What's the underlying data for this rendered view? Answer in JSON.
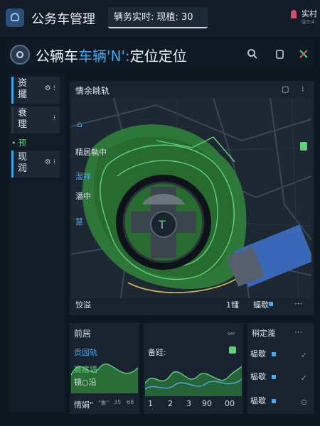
{
  "header": {
    "app_title": "公务车管理",
    "tab_label": "辆务实时: 现植: 30",
    "user_label": "实村",
    "user_sub": "@3:4"
  },
  "subheader": {
    "title_a": "公辆车",
    "title_b": "车辆",
    "title_c": "'N':",
    "title_d": "定位定位"
  },
  "sidebar": {
    "items": [
      {
        "label": "资擺"
      },
      {
        "label": "衰理"
      },
      {
        "label": "现润"
      }
    ],
    "dot_label": "预"
  },
  "map_panel": {
    "title": "情余眺轨",
    "labels": [
      "精居執中",
      "湿祥",
      "潘中",
      "慧"
    ],
    "foot_left": "饺溢",
    "foot_count": "1镭",
    "foot_right": "蝠歇"
  },
  "bottom": {
    "left": {
      "title": "前居",
      "items": [
        "贡园轨",
        "赛瘩墙",
        "镜○沿"
      ],
      "foot_label": "情娟\"",
      "foot_nums": [
        "\"象\"",
        "35",
        "68"
      ]
    },
    "middle": {
      "label": "备跬:",
      "corner": "ser",
      "ticks": [
        "1",
        "2",
        "3",
        "90",
        "00"
      ]
    },
    "right": {
      "title": "稍定瀧",
      "rows": [
        "榀歇",
        "榀歇",
        "榀歇"
      ]
    }
  },
  "colors": {
    "accent": "#3ea6e8",
    "map_green": "#2f7f3a",
    "route": "#5fd07c",
    "truck_blue": "#3a68b8"
  }
}
